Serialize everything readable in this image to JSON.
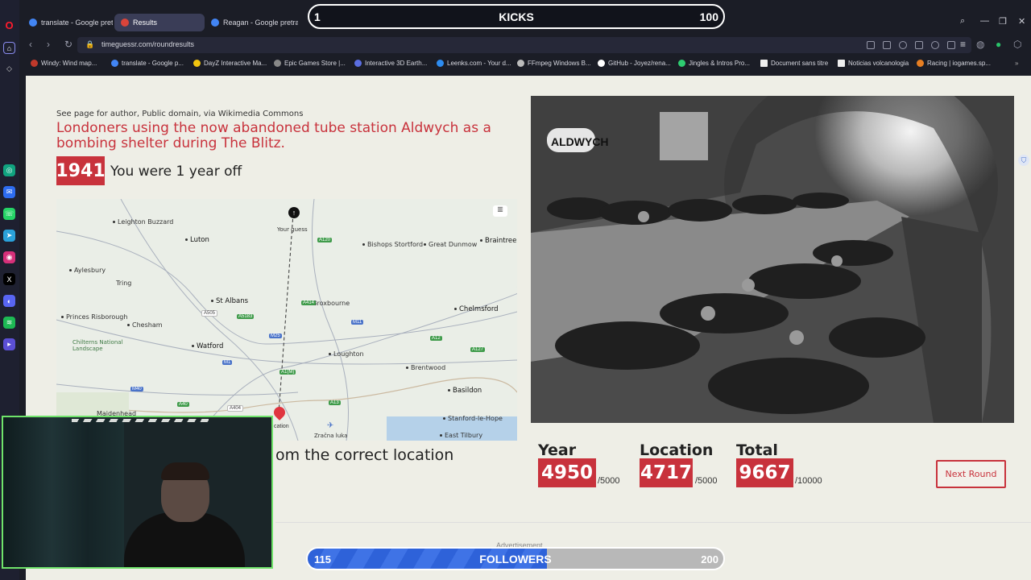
{
  "browser": {
    "tabs": [
      {
        "label": "translate - Google pretraž",
        "color": "#4285f4"
      },
      {
        "label": "Results",
        "color": "#d9443a"
      },
      {
        "label": "Reagan - Google pretraži",
        "color": "#4285f4"
      }
    ],
    "url": "timeguessr.com/roundresults",
    "bookmarks": [
      {
        "label": "Windy: Wind map...",
        "color": "#c0392b"
      },
      {
        "label": "translate - Google p...",
        "color": "#4285f4"
      },
      {
        "label": "DayZ Interactive Ma...",
        "color": "#f1c40f"
      },
      {
        "label": "Epic Games Store |...",
        "color": "#888888"
      },
      {
        "label": "Interactive 3D Earth...",
        "color": "#5b6ee1"
      },
      {
        "label": "Leenks.com - Your d...",
        "color": "#2d8cf0"
      },
      {
        "label": "FFmpeg Windows B...",
        "color": "#bbbbbb"
      },
      {
        "label": "GitHub - Joyez/rena...",
        "color": "#ffffff"
      },
      {
        "label": "Jingles & Intros Pro...",
        "color": "#2ecc71"
      },
      {
        "label": "Document sans titre",
        "color": "#eeeeee"
      },
      {
        "label": "Noticias volcanologia",
        "color": "#eeeeee"
      },
      {
        "label": "Racing | iogames.sp...",
        "color": "#e67e22"
      }
    ]
  },
  "result": {
    "attribution": "See page for author, Public domain, via Wikimedia Commons",
    "headline": "Londoners using the now abandoned tube station Aldwych as a bombing shelter during The Blitz.",
    "year": "1941",
    "year_feedback": "You were 1 year off",
    "distance_feedback": "om the correct location"
  },
  "map": {
    "your_guess_label": "Your guess",
    "location_label": "cation",
    "towns": [
      {
        "name": "Leighton Buzzard",
        "big": false
      },
      {
        "name": "Luton",
        "big": true
      },
      {
        "name": "Aylesbury",
        "big": false
      },
      {
        "name": "Tring",
        "big": false
      },
      {
        "name": "St Albans",
        "big": true
      },
      {
        "name": "Princes Risborough",
        "big": false
      },
      {
        "name": "Chesham",
        "big": false
      },
      {
        "name": "Chilterns National Landscape",
        "big": false
      },
      {
        "name": "Watford",
        "big": true
      },
      {
        "name": "Maidenhead",
        "big": false
      },
      {
        "name": "Bishops Stortford",
        "big": false
      },
      {
        "name": "Great Dunmow",
        "big": false
      },
      {
        "name": "Braintree",
        "big": true
      },
      {
        "name": "Broxbourne",
        "big": false
      },
      {
        "name": "Chelmsford",
        "big": true
      },
      {
        "name": "Loughton",
        "big": false
      },
      {
        "name": "Brentwood",
        "big": false
      },
      {
        "name": "Basildon",
        "big": true
      },
      {
        "name": "Stanford-le-Hope",
        "big": false
      },
      {
        "name": "East Tilbury",
        "big": false
      },
      {
        "name": "Zračna luka",
        "big": false
      }
    ],
    "roads": [
      "A505",
      "M25",
      "A1(M)",
      "M11",
      "A120",
      "A414",
      "A12",
      "A127",
      "A13",
      "M1",
      "A5183",
      "A404",
      "M40",
      "A40",
      "A130"
    ]
  },
  "scores": {
    "year_label": "Year",
    "year_value": "4950",
    "year_max": "/5000",
    "location_label": "Location",
    "location_value": "4717",
    "location_max": "/5000",
    "total_label": "Total",
    "total_value": "9667",
    "total_max": "/10000",
    "next_button": "Next Round",
    "ad_label": "Advertisement"
  },
  "overlay": {
    "kicks_current": "1",
    "kicks_label": "KICKS",
    "kicks_goal": "100",
    "followers_current": "115",
    "followers_label": "FOLLOWERS",
    "followers_goal": "200",
    "followers_progress": 0.575
  },
  "photo": {
    "sign_text": "ALDWYCH"
  }
}
